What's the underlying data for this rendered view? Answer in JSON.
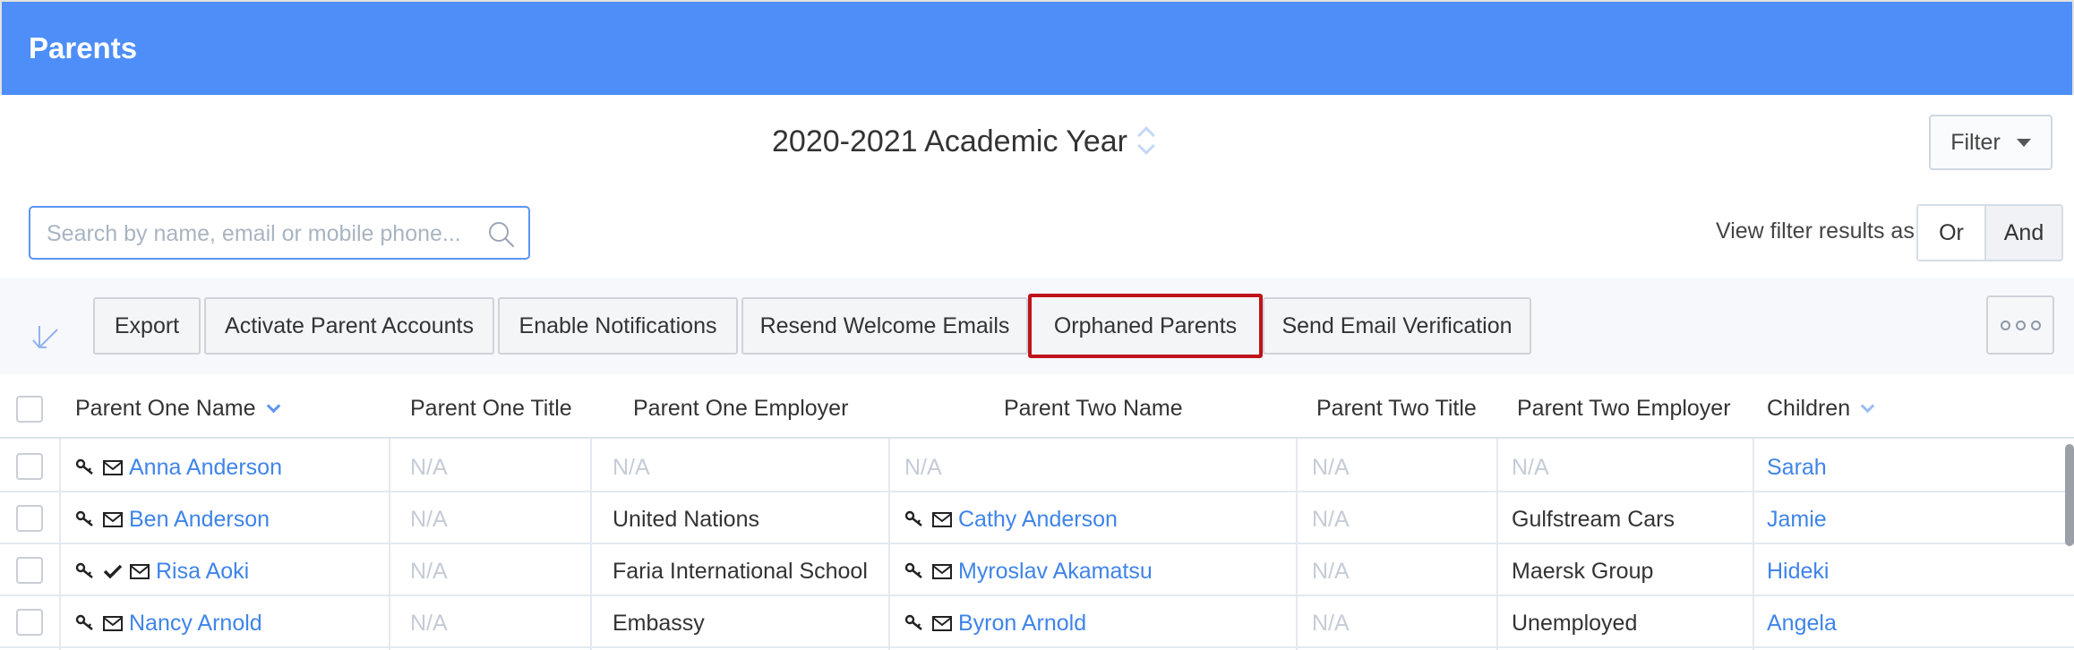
{
  "header": {
    "title": "Parents"
  },
  "academic_year": {
    "label": "2020-2021 Academic Year"
  },
  "filter": {
    "label": "Filter"
  },
  "search": {
    "placeholder": "Search by name, email or mobile phone..."
  },
  "view_filter": {
    "label": "View filter results as:",
    "options": [
      "Or",
      "And"
    ],
    "selected": "And"
  },
  "toolbar": {
    "buttons": [
      "Export",
      "Activate Parent Accounts",
      "Enable Notifications",
      "Resend Welcome Emails",
      "Orphaned Parents",
      "Send Email Verification"
    ],
    "highlighted": "Orphaned Parents"
  },
  "table": {
    "columns": [
      "Parent One Name",
      "Parent One Title",
      "Parent One Employer",
      "Parent Two Name",
      "Parent Two Title",
      "Parent Two Employer",
      "Children"
    ],
    "rows": [
      {
        "p1_name": "Anna Anderson",
        "p1_icons": [
          "key-icon",
          "mail-icon"
        ],
        "p1_title": "N/A",
        "p1_employer": "N/A",
        "p2_name": "N/A",
        "p2_icons": [],
        "p2_title": "N/A",
        "p2_employer": "N/A",
        "children": "Sarah"
      },
      {
        "p1_name": "Ben Anderson",
        "p1_icons": [
          "key-icon",
          "mail-icon"
        ],
        "p1_title": "N/A",
        "p1_employer": "United Nations",
        "p2_name": "Cathy Anderson",
        "p2_icons": [
          "key-icon",
          "mail-icon"
        ],
        "p2_title": "N/A",
        "p2_employer": "Gulfstream Cars",
        "children": "Jamie"
      },
      {
        "p1_name": "Risa Aoki",
        "p1_icons": [
          "key-icon",
          "check-icon",
          "mail-icon"
        ],
        "p1_title": "N/A",
        "p1_employer": "Faria International School",
        "p2_name": "Myroslav Akamatsu",
        "p2_icons": [
          "key-icon",
          "mail-icon"
        ],
        "p2_title": "N/A",
        "p2_employer": "Maersk Group",
        "children": "Hideki"
      },
      {
        "p1_name": "Nancy Arnold",
        "p1_icons": [
          "key-icon",
          "mail-icon"
        ],
        "p1_title": "N/A",
        "p1_employer": "Embassy",
        "p2_name": "Byron Arnold",
        "p2_icons": [
          "key-icon",
          "mail-icon"
        ],
        "p2_title": "N/A",
        "p2_employer": "Unemployed",
        "children": "Angela"
      }
    ]
  },
  "colors": {
    "header_bg": "#4d8ef8",
    "link": "#3f84e8",
    "highlight_border": "#c0121a",
    "muted": "#c5ccd6"
  }
}
